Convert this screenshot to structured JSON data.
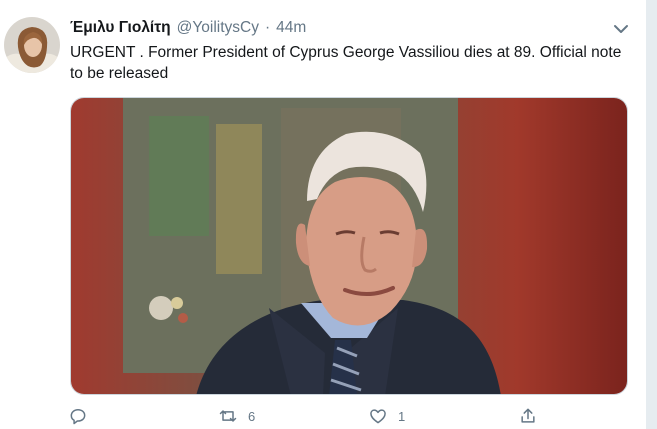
{
  "tweet": {
    "display_name": "Έμιλυ Γιολίτη",
    "handle": "@YoilitysCy",
    "separator": "·",
    "time": "44m",
    "text": "URGENT . Former President of Cyprus George Vassiliou dies at 89. Official note to be released"
  },
  "actions": {
    "reply_count": "",
    "retweet_count": "6",
    "like_count": "1",
    "share_count": ""
  },
  "icons": {
    "more": "chevron-down-icon",
    "reply": "reply-icon",
    "retweet": "retweet-icon",
    "like": "heart-icon",
    "share": "share-icon"
  },
  "colors": {
    "text": "#14171a",
    "secondary": "#657786",
    "border": "#ccd6dd"
  }
}
